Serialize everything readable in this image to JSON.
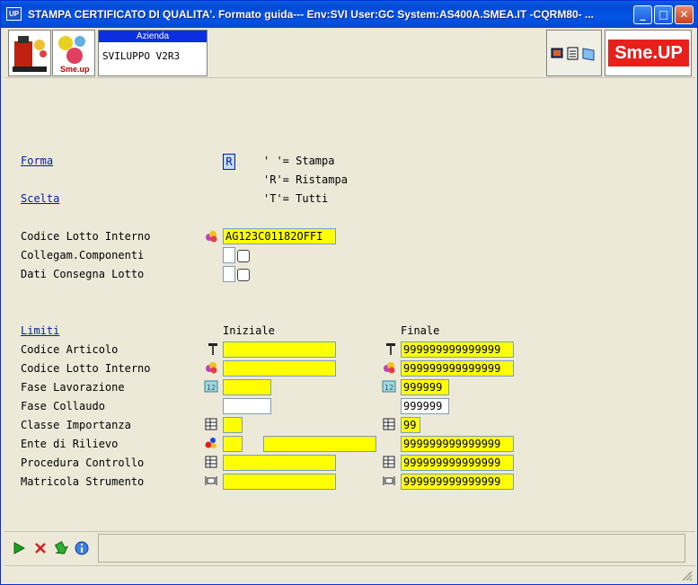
{
  "window": {
    "title": "STAMPA CERTIFICATO DI QUALITA'.  Formato  guida--- Env:SVI User:GC System:AS400A.SMEA.IT -CQRM80- ...",
    "app_icon_text": "UP",
    "minimize": "_",
    "maximize": "□",
    "close": "✕"
  },
  "header": {
    "azienda_label": "Azienda",
    "azienda_value": "SVILUPPO V2R3",
    "brand": "Sme.UP"
  },
  "form": {
    "forma_label": "Forma",
    "forma_value": "R",
    "scelta_label": "Scelta",
    "options": [
      "' '= Stampa",
      "'R'= Ristampa",
      "'T'= Tutti"
    ],
    "codice_lotto_label": "Codice Lotto Interno",
    "codice_lotto_value": "AG123C01182OFFI",
    "collegam_label": "Collegam.Componenti",
    "dati_consegna_label": "Dati Consegna Lotto"
  },
  "limiti": {
    "label": "Limiti",
    "iniziale_header": "Iniziale",
    "finale_header": "Finale",
    "rows": [
      {
        "label": "Codice Articolo",
        "iniziale": "",
        "finale": "999999999999999",
        "icon": "hammer-icon"
      },
      {
        "label": "Codice Lotto Interno",
        "iniziale": "",
        "finale": "999999999999999",
        "icon": "lot-icon"
      },
      {
        "label": "Fase Lavorazione",
        "iniziale": "",
        "finale": "999999",
        "icon": "number-icon"
      },
      {
        "label": "Fase Collaudo",
        "iniziale": "",
        "finale": "999999",
        "icon": ""
      },
      {
        "label": "Classe Importanza",
        "iniziale": "",
        "finale": "99",
        "icon": "table-icon"
      },
      {
        "label": "Ente di Rilievo",
        "iniziale": "",
        "iniziale2": "",
        "finale": "999999999999999",
        "icon": "entity-icon"
      },
      {
        "label": "Procedura Controllo",
        "iniziale": "",
        "finale": "999999999999999",
        "icon": "table-icon"
      },
      {
        "label": "Matricola Strumento",
        "iniziale": "",
        "finale": "999999999999999",
        "icon": "ruler-icon"
      }
    ]
  },
  "colors": {
    "field_yellow": "#ffff00",
    "link_blue": "#0020a0",
    "title_blue": "#0355e8"
  }
}
